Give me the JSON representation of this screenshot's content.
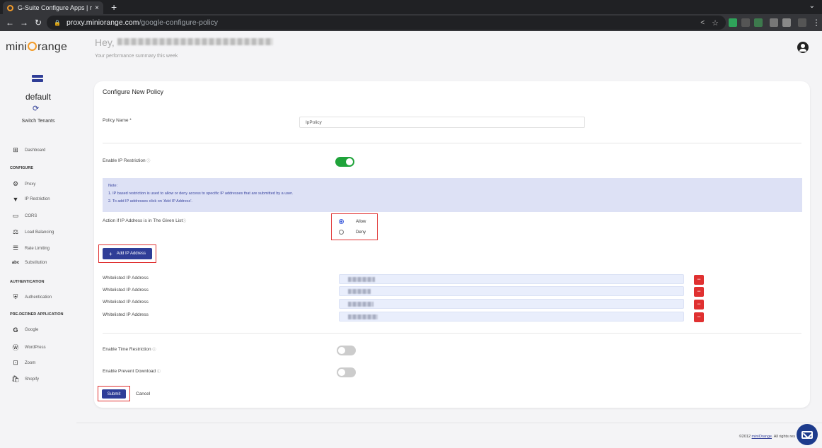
{
  "browser": {
    "tab_title": "G-Suite Configure Apps | mi",
    "tab_close": "×",
    "new_tab": "+",
    "tab_menu": "⌄",
    "url_host": "proxy.miniorange.com",
    "url_path": "/google-configure-policy",
    "icons": [
      "back-icon",
      "forward-icon",
      "reload-icon",
      "lock-icon",
      "share-icon",
      "star-icon"
    ]
  },
  "sidebar": {
    "logo": {
      "before": "mini",
      "after": "range"
    },
    "tenant_name": "default",
    "switch_label": "Switch Tenants",
    "dashboard": "Dashboard",
    "sections": {
      "configure": "CONFIGURE",
      "authentication": "AUTHENTICATION",
      "predefined": "PRE-DEFINED APPLICATION"
    },
    "items": {
      "proxy": "Proxy",
      "ip_restriction": "IP Restriction",
      "cors": "CORS",
      "load_balancing": "Load Balancing",
      "rate_limiting": "Rate Limiting",
      "substitution": "Substitution",
      "authentication": "Authentication",
      "google": "Google",
      "wordpress": "WordPress",
      "zoom": "Zoom",
      "shopify": "Shopify"
    }
  },
  "header": {
    "greeting": "Hey,",
    "subtitle": "Your performance summary this week"
  },
  "form": {
    "title": "Configure New Policy",
    "policy_name_label": "Policy Name *",
    "policy_name_value": "IpPolicy",
    "ip_restriction_label": "Enable IP Restriction",
    "ip_restriction_enabled": true,
    "note": {
      "title": "Note:",
      "line1": "1. IP based restriction is used to allow or deny access to specific IP addresses that are submitted by a user.",
      "line2": "2. To add IP addresses click on 'Add IP Address'."
    },
    "action_label": "Action if IP Address is in The Given List",
    "action_options": [
      "Allow",
      "Deny"
    ],
    "action_selected": "Allow",
    "add_ip_button": "Add IP Address",
    "whitelist_label": "Whitelisted IP Address",
    "whitelist_count": 4,
    "remove_button": "−",
    "time_restriction_label": "Enable Time Restriction",
    "time_restriction_enabled": false,
    "prevent_download_label": "Enable Prevent Download",
    "prevent_download_enabled": false,
    "submit": "Submit",
    "cancel": "Cancel"
  },
  "footer": {
    "copyright": "©2012",
    "brand_link": "miniOrange",
    "rights": ". All rights res"
  },
  "colors": {
    "brand_blue": "#2f3d97",
    "toggle_on": "#1fa33a",
    "danger": "#e03131",
    "note_bg": "#dde1f5"
  }
}
